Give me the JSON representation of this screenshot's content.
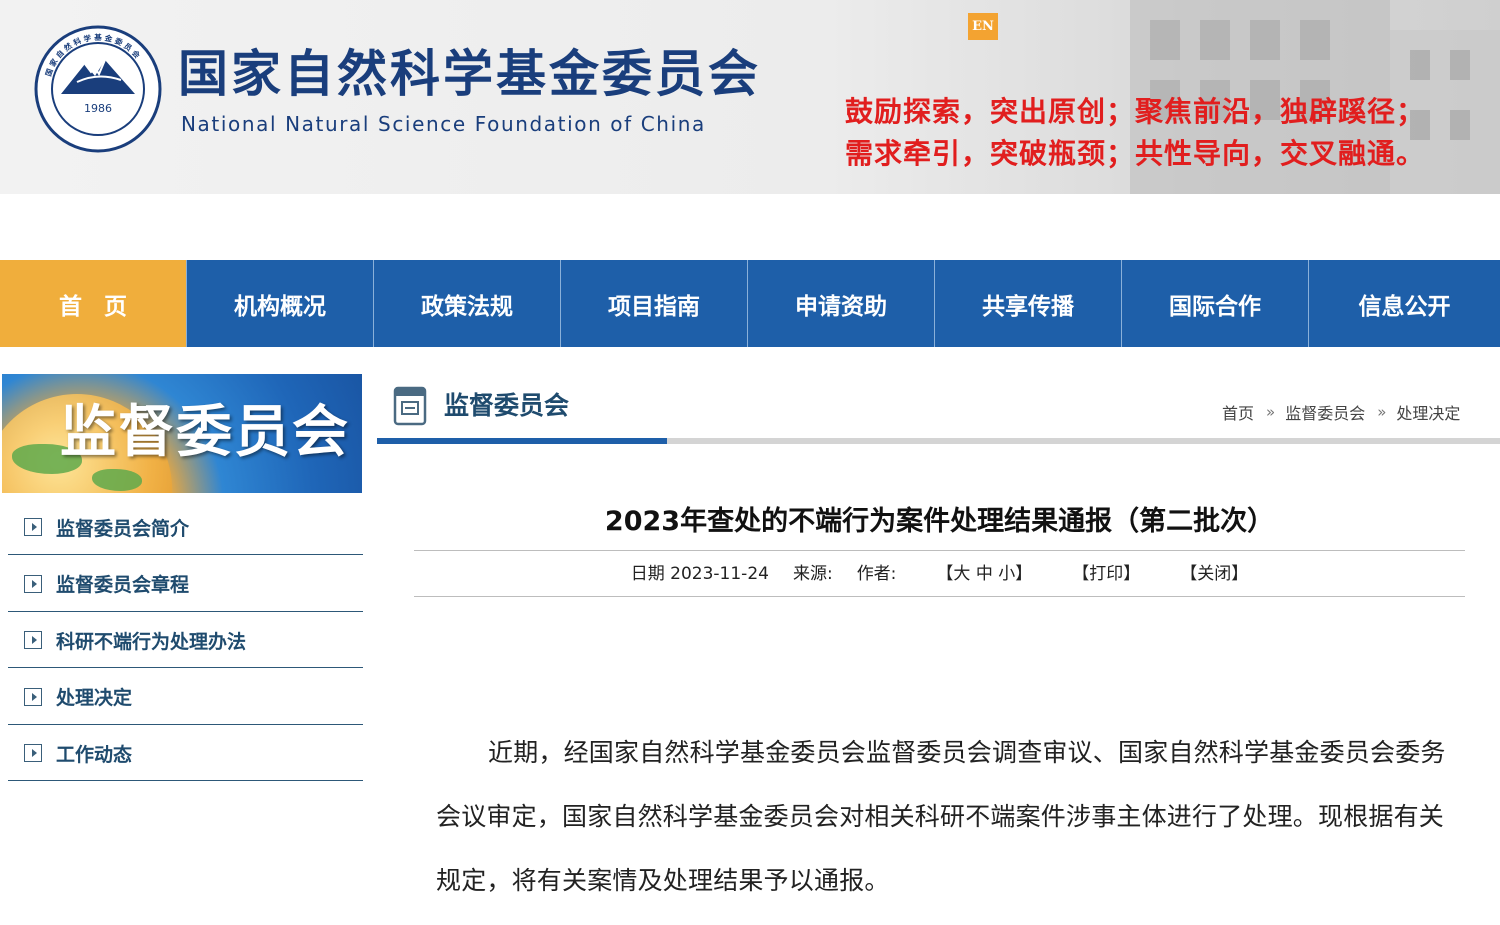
{
  "header": {
    "site_name_cn": "国家自然科学基金委员会",
    "site_name_en": "National Natural Science Foundation of China",
    "logo_year": "1986",
    "lang_button": "EN",
    "slogan_line1": "鼓励探索，突出原创；聚焦前沿，独辟蹊径；",
    "slogan_line2": "需求牵引，突破瓶颈；共性导向，交叉融通。",
    "slogan_color": "#e11e1e"
  },
  "nav": {
    "items": [
      {
        "label": "首页"
      },
      {
        "label": "机构概况"
      },
      {
        "label": "政策法规"
      },
      {
        "label": "项目指南"
      },
      {
        "label": "申请资助"
      },
      {
        "label": "共享传播"
      },
      {
        "label": "国际合作"
      },
      {
        "label": "信息公开"
      }
    ],
    "active_index": 0,
    "colors": {
      "bar": "#1e5fa9",
      "active": "#f0ae3c"
    }
  },
  "sidebar": {
    "banner_title": "监督委员会",
    "items": [
      {
        "label": "监督委员会简介"
      },
      {
        "label": "监督委员会章程"
      },
      {
        "label": "科研不端行为处理办法"
      },
      {
        "label": "处理决定"
      },
      {
        "label": "工作动态"
      }
    ]
  },
  "section": {
    "title": "监督委员会",
    "breadcrumb": [
      "首页",
      "监督委员会",
      "处理决定"
    ],
    "breadcrumb_separator": "»"
  },
  "article": {
    "title": "2023年查处的不端行为案件处理结果通报（第二批次）",
    "date_label": "日期",
    "date": "2023-11-24",
    "source_label": "来源:",
    "author_label": "作者:",
    "font_size_control": "【大 中 小】",
    "print_label": "【打印】",
    "close_label": "【关闭】",
    "body": "近期，经国家自然科学基金委员会监督委员会调查审议、国家自然科学基金委员会委务会议审定，国家自然科学基金委员会对相关科研不端案件涉事主体进行了处理。现根据有关规定，将有关案情及处理结果予以通报。"
  }
}
